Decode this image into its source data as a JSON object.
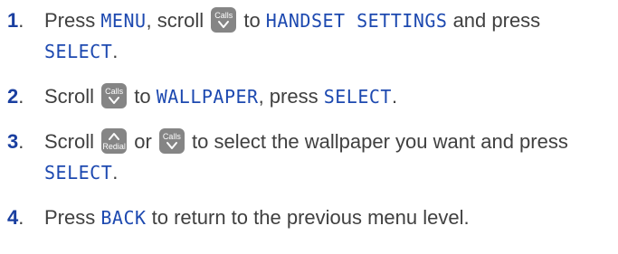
{
  "steps": [
    {
      "number": "1",
      "parts": {
        "t1": "Press ",
        "lcd1": "MENU",
        "t2": ", scroll ",
        "t3": " to ",
        "lcd2": "HANDSET SETTINGS",
        "t4": " and press ",
        "lcd3": "SELECT",
        "t5": "."
      }
    },
    {
      "number": "2",
      "parts": {
        "t1": "Scroll ",
        "t2": " to ",
        "lcd1": "WALLPAPER",
        "t3": ", press ",
        "lcd2": "SELECT",
        "t4": "."
      }
    },
    {
      "number": "3",
      "parts": {
        "t1": "Scroll ",
        "t2": " or ",
        "t3": " to select the wallpaper you want and press ",
        "lcd1": "SELECT",
        "t4": "."
      }
    },
    {
      "number": "4",
      "parts": {
        "t1": "Press ",
        "lcd1": "BACK",
        "t2": " to return to the previous menu level."
      }
    }
  ],
  "keys": {
    "calls_label": "Calls",
    "redial_label": "Redial",
    "calls_icon": "chevron-down-icon",
    "redial_icon": "chevron-up-icon"
  },
  "colors": {
    "step_number": "#1a3fa0",
    "lcd_text": "#1d49b0",
    "body_text": "#404040",
    "key_background": "#858585"
  }
}
